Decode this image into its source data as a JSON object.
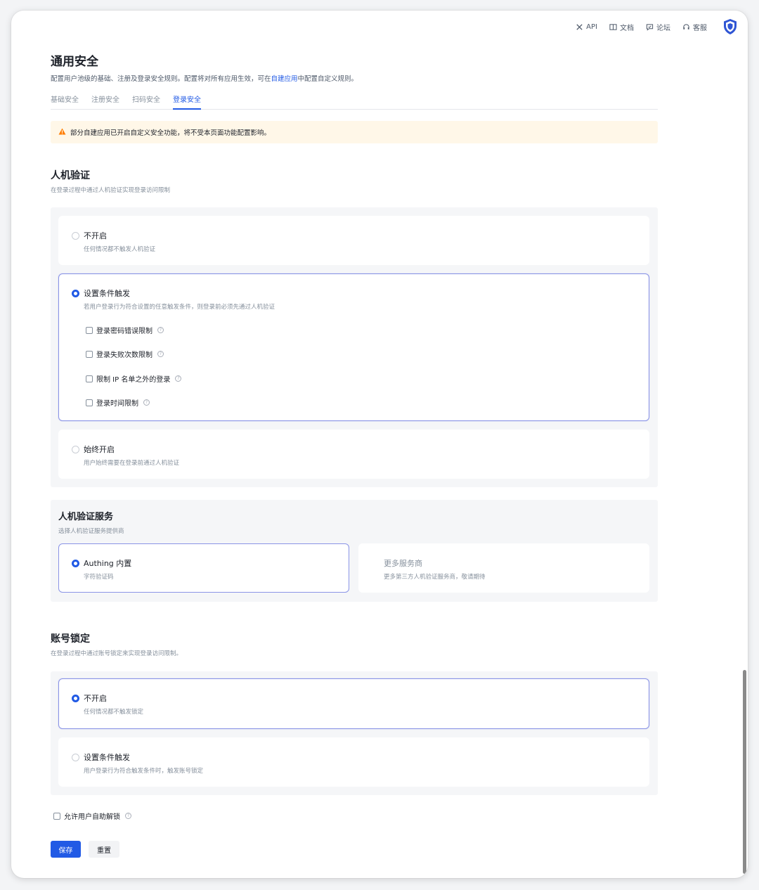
{
  "topbar": {
    "items": [
      {
        "label": "API",
        "icon": "tools-icon"
      },
      {
        "label": "文档",
        "icon": "book-icon"
      },
      {
        "label": "论坛",
        "icon": "chat-icon"
      },
      {
        "label": "客服",
        "icon": "headset-icon"
      }
    ],
    "logo": "shield-logo"
  },
  "page": {
    "title": "通用安全",
    "desc_before": "配置用户池级的基础、注册及登录安全规则。配置将对所有应用生效，可在",
    "desc_link": "自建应用",
    "desc_after": "中配置自定义规则。"
  },
  "tabs": [
    {
      "label": "基础安全",
      "active": false
    },
    {
      "label": "注册安全",
      "active": false
    },
    {
      "label": "扫码安全",
      "active": false
    },
    {
      "label": "登录安全",
      "active": true
    }
  ],
  "alert": {
    "text": "部分自建应用已开启自定义安全功能，将不受本页面功能配置影响。",
    "color": "#ff7d00"
  },
  "captcha": {
    "title": "人机验证",
    "desc": "在登录过程中通过人机验证实现登录访问限制",
    "options": [
      {
        "title": "不开启",
        "desc": "任何情况都不触发人机验证",
        "selected": false
      },
      {
        "title": "设置条件触发",
        "desc": "若用户登录行为符合设置的任意触发条件，则登录前必须先通过人机验证",
        "selected": true
      },
      {
        "title": "始终开启",
        "desc": "用户始终需要在登录前通过人机验证",
        "selected": false
      }
    ],
    "conditions": [
      {
        "label": "登录密码错误限制",
        "checked": false
      },
      {
        "label": "登录失败次数限制",
        "checked": false
      },
      {
        "label": "限制 IP 名单之外的登录",
        "checked": false
      },
      {
        "label": "登录时间限制",
        "checked": false
      }
    ]
  },
  "captcha_service": {
    "title": "人机验证服务",
    "desc": "选择人机验证服务提供商",
    "providers": [
      {
        "title": "Authing 内置",
        "desc": "字符验证码",
        "selected": true
      },
      {
        "title": "更多服务商",
        "desc": "更多第三方人机验证服务商，敬请期待",
        "selected": false
      }
    ]
  },
  "lock": {
    "title": "账号锁定",
    "desc": "在登录过程中通过账号锁定来实现登录访问限制。",
    "options": [
      {
        "title": "不开启",
        "desc": "任何情况都不触发锁定",
        "selected": true
      },
      {
        "title": "设置条件触发",
        "desc": "用户登录行为符合触发条件时，触发账号锁定",
        "selected": false
      }
    ],
    "self_unlock": {
      "label": "允许用户自助解锁",
      "checked": false
    }
  },
  "actions": {
    "save": "保存",
    "reset": "重置"
  },
  "colors": {
    "primary": "#215ae5",
    "selected_border": "#8a94e6",
    "panel_bg": "#f5f6f8",
    "alert_bg": "#fff7e8"
  }
}
